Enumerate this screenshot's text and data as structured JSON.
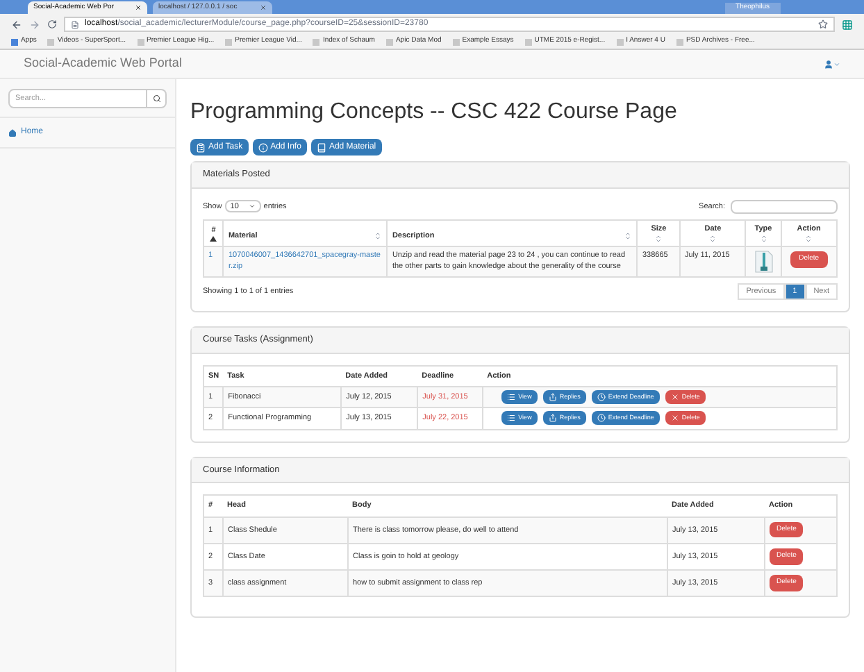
{
  "browser": {
    "tabs": [
      {
        "title": "Social-Academic Web Por",
        "selected": true
      },
      {
        "title": "localhost / 127.0.0.1 / soc",
        "selected": false
      }
    ],
    "user": "Theophilus",
    "url_host": "localhost",
    "url_path": "/social_academic/lecturerModule/course_page.php?courseID=25&sessionID=23780",
    "bookmarks": [
      "Apps",
      "Videos - SuperSport...",
      "Premier League Hig...",
      "Premier League Vid...",
      "Index of Schaum",
      "Apic Data Mod",
      "Example Essays",
      "UTME 2015 e-Regist...",
      "I Answer 4 U",
      "PSD Archives - Free..."
    ]
  },
  "navbar": {
    "brand": "Social-Academic Web Portal"
  },
  "sidebar": {
    "search_placeholder": "Search...",
    "items": [
      {
        "label": "Home"
      }
    ]
  },
  "page": {
    "title": "Programming Concepts -- CSC 422 Course Page",
    "actions": [
      {
        "label": "Add Task",
        "kind": "task"
      },
      {
        "label": "Add Info",
        "kind": "info"
      },
      {
        "label": "Add Material",
        "kind": "material"
      }
    ]
  },
  "materials": {
    "heading": "Materials Posted",
    "show_label": "Show",
    "page_size": "10",
    "entries_label": "entries",
    "search_label": "Search:",
    "columns": [
      "#",
      "Material",
      "Description",
      "Size",
      "Date",
      "Type",
      "Action"
    ],
    "rows": [
      {
        "num": "1",
        "material": "1070046007_1436642701_spacegray-master.zip",
        "description": "Unzip and read the material page 23 to 24 , you can continue to read the other parts to gain knowledge about the generality of the course",
        "size": "338665",
        "date": "July 11, 2015",
        "action": "Delete"
      }
    ],
    "info": "Showing 1 to 1 of 1 entries",
    "pages": [
      {
        "label": "Previous",
        "selected": false
      },
      {
        "label": "1",
        "selected": true
      },
      {
        "label": "Next",
        "selected": false
      }
    ]
  },
  "tasks": {
    "heading": "Course Tasks (Assignment)",
    "columns": [
      "SN",
      "Task",
      "Date Added",
      "Deadline",
      "Action"
    ],
    "rows": [
      {
        "sn": "1",
        "task": "Fibonacci",
        "date_added": "July 12, 2015",
        "deadline": "July 31, 2015",
        "actions": [
          "View",
          "Replies",
          "Extend Deadline",
          "Delete"
        ]
      },
      {
        "sn": "2",
        "task": "Functional Programming",
        "date_added": "July 13, 2015",
        "deadline": "July 22, 2015",
        "actions": [
          "View",
          "Replies",
          "Extend Deadline",
          "Delete"
        ]
      }
    ]
  },
  "information": {
    "heading": "Course Information",
    "columns": [
      "#",
      "Head",
      "Body",
      "Date Added",
      "Action"
    ],
    "rows": [
      {
        "num": "1",
        "head": "Class Shedule",
        "body": "There is class tomorrow please, do well to attend",
        "date": "July 13, 2015",
        "action": "Delete"
      },
      {
        "num": "2",
        "head": "Class Date",
        "body": "Class is goin to hold at geology",
        "date": "July 13, 2015",
        "action": "Delete"
      },
      {
        "num": "3",
        "head": "class assignment",
        "body": "how to submit assignment to class rep",
        "date": "July 13, 2015",
        "action": "Delete"
      }
    ]
  }
}
